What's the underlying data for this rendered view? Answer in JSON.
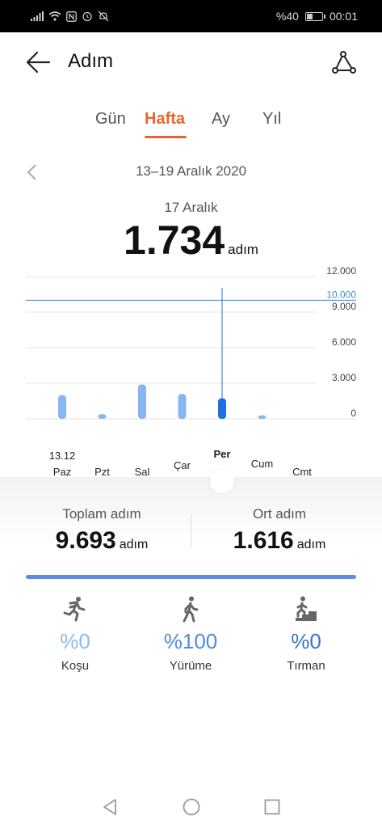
{
  "status": {
    "battery": "%40",
    "battery_level": 0.4,
    "time": "00:01"
  },
  "header": {
    "title": "Adım",
    "back_icon": "arrow-left-icon",
    "route_icon": "route-icon"
  },
  "tabs": [
    {
      "label": "Gün",
      "active": false
    },
    {
      "label": "Hafta",
      "active": true
    },
    {
      "label": "Ay",
      "active": false
    },
    {
      "label": "Yıl",
      "active": false
    }
  ],
  "period": {
    "range": "13–19 Aralık 2020"
  },
  "selection": {
    "date": "17 Aralık",
    "value": "1.734",
    "unit": "adım"
  },
  "chart_data": {
    "type": "bar",
    "categories": [
      "Paz",
      "Pzt",
      "Sal",
      "Çar",
      "Per",
      "Cum",
      "Cmt"
    ],
    "first_date_label": "13.12",
    "values": [
      2000,
      400,
      2900,
      2100,
      1734,
      300,
      0
    ],
    "selected_index": 4,
    "y_ticks": [
      "0",
      "3.000",
      "6.000",
      "9.000",
      "12.000"
    ],
    "y_tick_values": [
      0,
      3000,
      6000,
      9000,
      12000
    ],
    "goal_label": "10.000",
    "goal_value": 10000,
    "ylim": [
      0,
      12000
    ],
    "bar_color": "#88b6f0",
    "selected_bar_color": "#1f6fe0",
    "goal_color": "#3a8fd8"
  },
  "summary": {
    "total_label": "Toplam adım",
    "total_value": "9.693",
    "total_unit": "adım",
    "avg_label": "Ort adım",
    "avg_value": "1.616",
    "avg_unit": "adım"
  },
  "activity_progress": 1.0,
  "activities": [
    {
      "icon": "running-icon",
      "percent": "%0",
      "label": "Koşu",
      "color": "#8bbbf0"
    },
    {
      "icon": "walking-icon",
      "percent": "%100",
      "label": "Yürüme",
      "color": "#4f8be0"
    },
    {
      "icon": "climbing-icon",
      "percent": "%0",
      "label": "Tırman",
      "color": "#3a72c8"
    }
  ]
}
